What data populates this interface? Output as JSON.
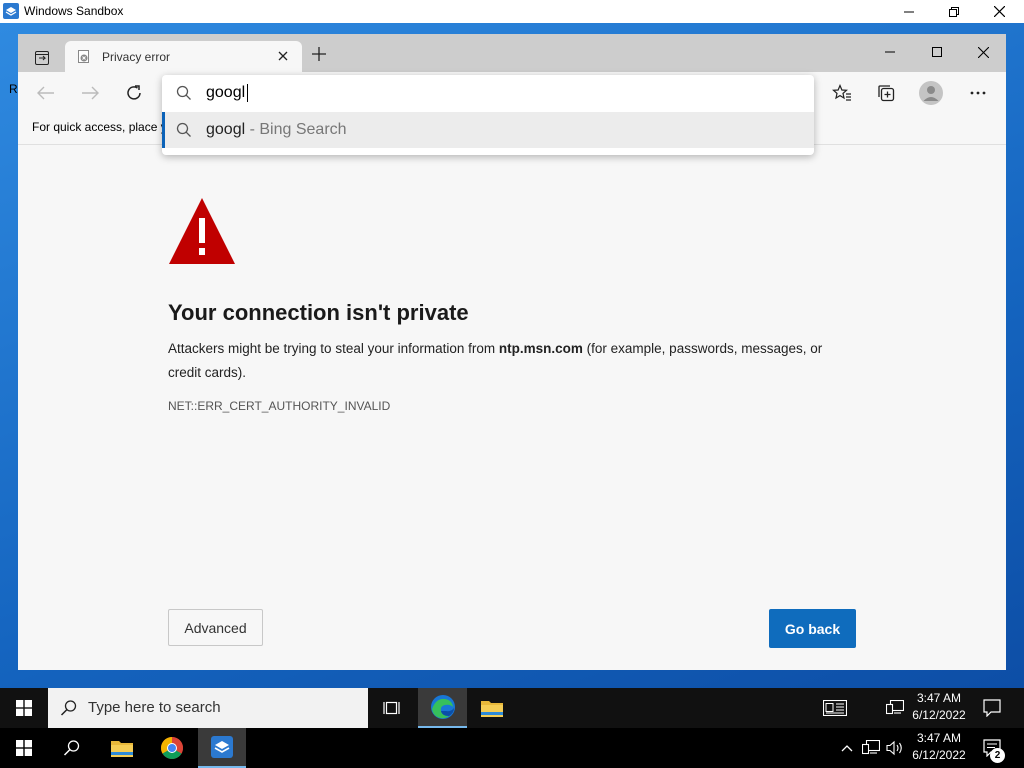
{
  "sandbox": {
    "title": "Windows Sandbox"
  },
  "desktop": {
    "partial_text": "R"
  },
  "browser": {
    "tab": {
      "title": "Privacy error"
    },
    "favorites_bar": {
      "text": "For quick access, place y"
    },
    "address_bar": {
      "value": "googl",
      "suggestion": {
        "query": "googl",
        "separator": " - ",
        "provider": "Bing Search"
      }
    }
  },
  "error_page": {
    "heading": "Your connection isn't private",
    "desc_prefix": "Attackers might be trying to steal your information from ",
    "desc_domain": "ntp.msn.com",
    "desc_suffix": " (for example, passwords, messages, or credit cards).",
    "error_code": "NET::ERR_CERT_AUTHORITY_INVALID",
    "advanced_label": "Advanced",
    "go_back_label": "Go back"
  },
  "inner_taskbar": {
    "search_placeholder": "Type here to search",
    "time": "3:47 AM",
    "date": "6/12/2022"
  },
  "outer_taskbar": {
    "time": "3:47 AM",
    "date": "6/12/2022",
    "notification_count": "2"
  },
  "colors": {
    "accent": "#0f6cbd",
    "warning_red": "#c00000",
    "desktop_blue": "#1e6fc7"
  }
}
